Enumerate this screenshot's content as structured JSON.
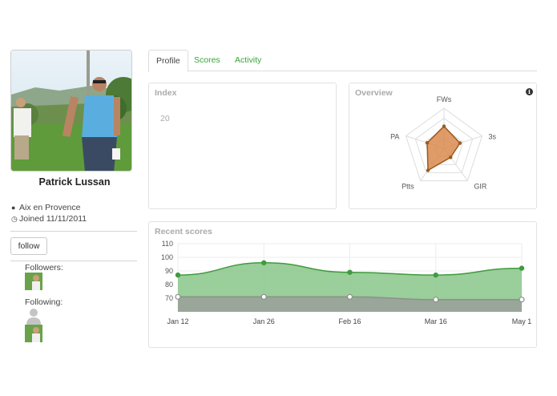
{
  "profile": {
    "name": "Patrick Lussan",
    "location": "Aix en Provence",
    "joined_prefix": "Joined",
    "joined_date": "11/11/2011",
    "follow_label": "follow",
    "followers_label": "Followers:",
    "following_label": "Following:"
  },
  "tabs": [
    {
      "label": "Profile",
      "active": true
    },
    {
      "label": "Scores",
      "active": false
    },
    {
      "label": "Activity",
      "active": false
    }
  ],
  "index_panel": {
    "title": "Index",
    "value": "20"
  },
  "overview_panel": {
    "title": "Overview",
    "info_icon": "info-icon",
    "radar": {
      "axes": [
        "FWs",
        "3s",
        "GIR",
        "Ptts",
        "PA"
      ],
      "values": [
        0.55,
        0.42,
        0.28,
        0.68,
        0.44
      ],
      "fill": "#d98a4e",
      "stroke": "#9b5a1f"
    }
  },
  "scores_panel": {
    "title": "Recent scores",
    "y_ticks": [
      "110",
      "100",
      "90",
      "80",
      "70"
    ],
    "x_labels": [
      "Jan 12",
      "Jan 26",
      "Feb 16",
      "Mar 16",
      "May 1"
    ]
  },
  "colors": {
    "accent_green": "#3aa33a",
    "series_upper": "#8fc98f",
    "series_lower": "#9aa39a"
  },
  "chart_data": {
    "type": "area",
    "title": "Recent scores",
    "categories": [
      "Jan 12",
      "Jan 26",
      "Feb 16",
      "Mar 16",
      "May 1"
    ],
    "ylim": [
      60,
      110
    ],
    "y_ticks": [
      70,
      80,
      90,
      100,
      110
    ],
    "grid": true,
    "series": [
      {
        "values": [
          87,
          96,
          89,
          87,
          92
        ]
      },
      {
        "values": [
          71,
          71,
          71,
          69,
          69
        ]
      }
    ]
  }
}
